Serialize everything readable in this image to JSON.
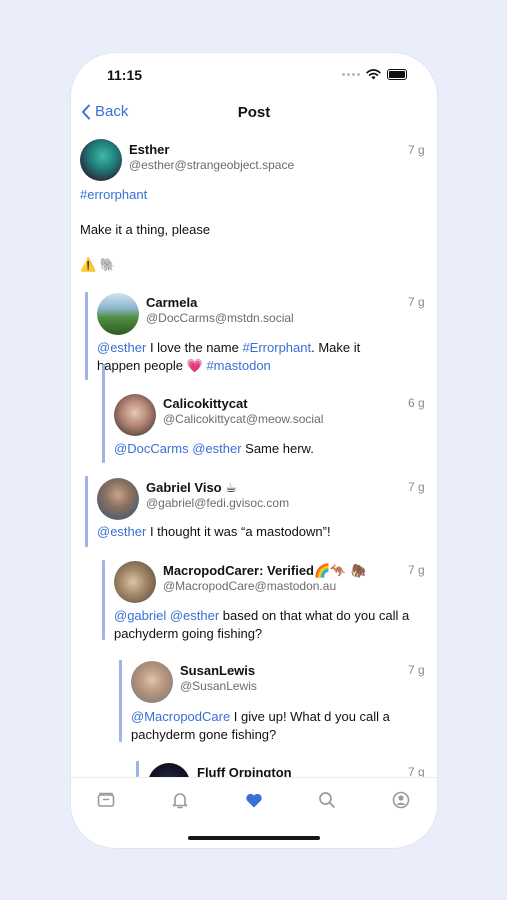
{
  "status_bar": {
    "time": "11:15"
  },
  "nav": {
    "back_label": "Back",
    "title": "Post"
  },
  "main_post": {
    "name": "Esther",
    "handle": "@esther@strangeobject.space",
    "time": "7 g",
    "hashtag": "#errorphant",
    "body": "Make it a thing, please",
    "emoji": "⚠️ 🐘"
  },
  "replies": [
    {
      "name": "Carmela",
      "handle": "@DocCarms@mstdn.social",
      "time": "7 g",
      "mention": "@esther",
      "text_a": " I love the name ",
      "tag1": "#Errorphant",
      "text_b": ". Make it happen people 💗 ",
      "tag2": "#mastodon"
    },
    {
      "name": "Calicokittycat",
      "handle": "@Calicokittycat@meow.social",
      "time": "6 g",
      "mention1": "@DocCarms",
      "mention2": "@esther",
      "text": " Same herw."
    },
    {
      "name": "Gabriel Viso ☕",
      "handle": "@gabriel@fedi.gvisoc.com",
      "time": "7 g",
      "mention": "@esther",
      "text": " I thought it  was “a mastodown”!"
    },
    {
      "name": "MacropodCarer: Verified🌈🦘 🦣",
      "handle": "@MacropodCare@mastodon.au",
      "time": "7 g",
      "mention1": "@gabriel",
      "mention2": "@esther",
      "text": " based on that what do you call a pachyderm going fishing?"
    },
    {
      "name": "SusanLewis",
      "handle": "@SusanLewis",
      "time": "7 g",
      "mention": "@MacropodCare",
      "text": " I give up! What d you call a pachyderm gone fishing?"
    },
    {
      "name": "Fluff Orpington",
      "time": "7 g"
    }
  ],
  "tab_bar": {
    "icons": [
      "inbox-icon",
      "bell-icon",
      "heart-icon",
      "search-icon",
      "profile-icon"
    ],
    "active": "heart-icon",
    "accent": "#3a6fd6"
  }
}
